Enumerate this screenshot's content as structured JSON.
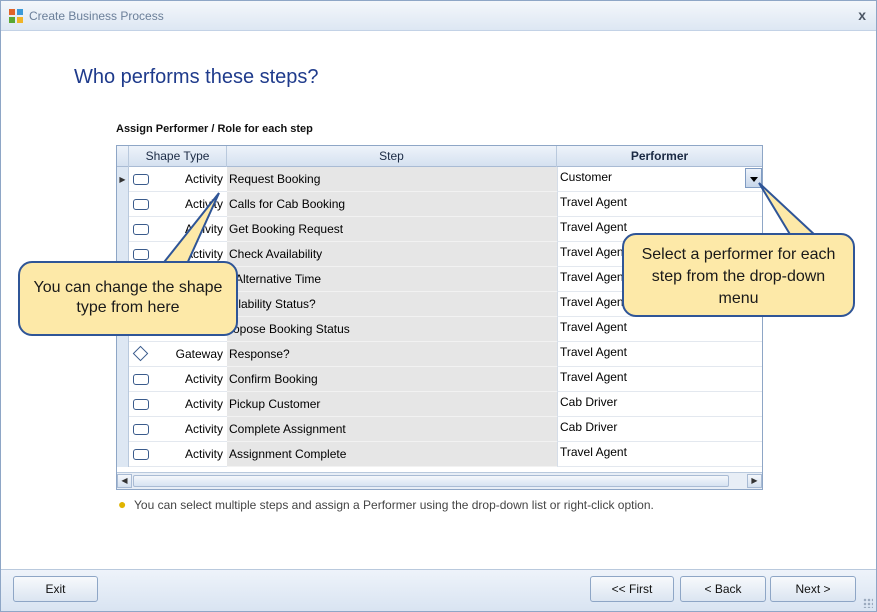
{
  "window": {
    "title": "Create Business Process",
    "close_label": "x"
  },
  "heading": "Who performs these steps?",
  "subheading": "Assign Performer / Role for each step",
  "grid": {
    "columns": {
      "shape_type": "Shape Type",
      "step": "Step",
      "performer": "Performer"
    },
    "rows": [
      {
        "shape": "Activity",
        "step": "Request Booking",
        "performer": "Customer"
      },
      {
        "shape": "Activity",
        "step": "Calls for Cab Booking",
        "performer": "Travel Agent"
      },
      {
        "shape": "Activity",
        "step": "Get Booking Request",
        "performer": "Travel Agent"
      },
      {
        "shape": "Activity",
        "step": "Check Availability",
        "performer": "Travel Agent"
      },
      {
        "shape": "",
        "step": "t Alternative Time",
        "performer": "Travel Agent"
      },
      {
        "shape": "",
        "step": "ailability Status?",
        "performer": "Travel Agent"
      },
      {
        "shape": "",
        "step": "ropose Booking Status",
        "performer": "Travel Agent"
      },
      {
        "shape": "Gateway",
        "step": "Response?",
        "performer": "Travel Agent"
      },
      {
        "shape": "Activity",
        "step": "Confirm Booking",
        "performer": "Travel Agent"
      },
      {
        "shape": "Activity",
        "step": "Pickup Customer",
        "performer": "Cab Driver"
      },
      {
        "shape": "Activity",
        "step": "Complete Assignment",
        "performer": "Cab Driver"
      },
      {
        "shape": "Activity",
        "step": "Assignment Complete",
        "performer": "Travel Agent"
      }
    ]
  },
  "hint": "You can select multiple steps and assign a Performer using the drop-down list or right-click option.",
  "callouts": {
    "left": "You can change the shape type from here",
    "right": "Select a performer for each step from the drop-down menu"
  },
  "footer": {
    "exit": "Exit",
    "first": "<< First",
    "back": "< Back",
    "next": "Next >"
  },
  "colors": {
    "heading": "#1f3b8c",
    "callout_fill": "#fde9a8",
    "callout_border": "#2f5597"
  }
}
